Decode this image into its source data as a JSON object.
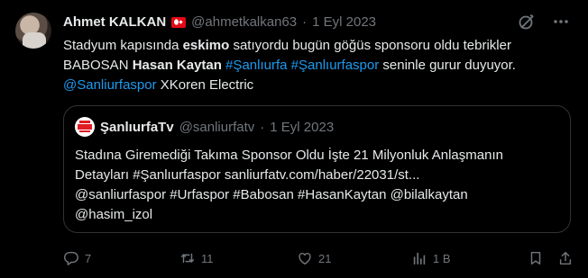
{
  "author": {
    "name": "Ahmet KALKAN",
    "handle": "@ahmetkalkan63",
    "separator": "·",
    "date": "1 Eyl 2023",
    "flag": "turkey-flag"
  },
  "tweet": {
    "t1": "Stadyum kapısında ",
    "t2": "eskimo",
    "t3": " satıyordu bugün göğüs sponsoru oldu tebrikler BABOSAN ",
    "t4": "Hasan Kaytan",
    "t5": " ",
    "tag1": "#Şanlıurfa",
    "t6": " ",
    "tag2": "#Şanlıurfaspor",
    "t7": " seninle gurur duyuyor.",
    "mention1": "@Sanliurfaspor",
    "t8": " XKoren Electric"
  },
  "quote": {
    "name": "ŞanlıurfaTv",
    "handle": "@sanliurfatv",
    "separator": "·",
    "date": "1 Eyl 2023",
    "line1": "Stadına Giremediği Takıma Sponsor Oldu İşte 21 Milyonluk Anlaşmanın",
    "line2": "Detayları #Şanlıurfaspor sanliurfatv.com/haber/22031/st...",
    "line3": "@sanliurfaspor #Urfaspor #Babosan #HasanKaytan @bilalkaytan",
    "line4": "@hasim_izol"
  },
  "actions": {
    "replies": "7",
    "retweets": "11",
    "likes": "21",
    "views": "1 B"
  },
  "colors": {
    "background": "#000000",
    "text": "#e7e9ea",
    "muted": "#71767b",
    "link": "#1d9bf0",
    "border": "#2f3336"
  }
}
